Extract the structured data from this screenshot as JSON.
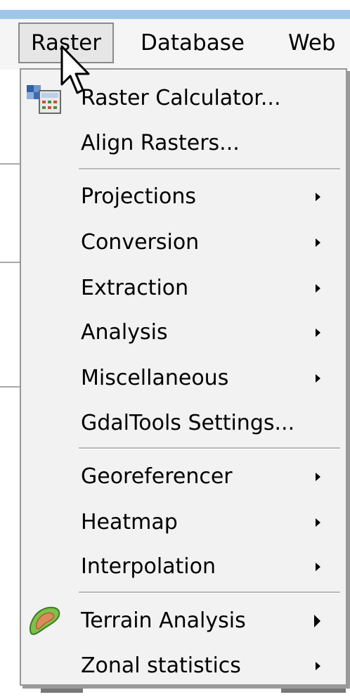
{
  "menubar": {
    "items": [
      {
        "label": "Raster"
      },
      {
        "label": "Database"
      },
      {
        "label": "Web"
      }
    ]
  },
  "raster_menu": {
    "group1": [
      {
        "label": "Raster Calculator...",
        "icon": "raster-calculator-icon"
      },
      {
        "label": "Align Rasters..."
      }
    ],
    "group2": [
      {
        "label": "Projections",
        "submenu": true
      },
      {
        "label": "Conversion",
        "submenu": true
      },
      {
        "label": "Extraction",
        "submenu": true
      },
      {
        "label": "Analysis",
        "submenu": true
      },
      {
        "label": "Miscellaneous",
        "submenu": true
      },
      {
        "label": "GdalTools Settings..."
      }
    ],
    "group3": [
      {
        "label": "Georeferencer",
        "submenu": true
      },
      {
        "label": "Heatmap",
        "submenu": true
      },
      {
        "label": "Interpolation",
        "submenu": true
      }
    ],
    "group4": [
      {
        "label": "Terrain Analysis",
        "submenu": true,
        "icon": "terrain-analysis-icon"
      },
      {
        "label": "Zonal statistics",
        "submenu": true
      }
    ]
  },
  "colors": {
    "titlebar": "#9fc6ea",
    "menu_background": "#f2f2f2",
    "menu_border": "#979797"
  }
}
